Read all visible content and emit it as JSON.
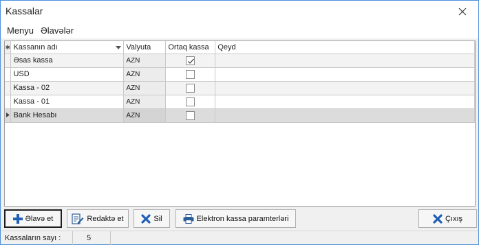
{
  "window": {
    "title": "Kassalar"
  },
  "menu": {
    "items": [
      "Menyu",
      "Əlavələr"
    ]
  },
  "grid": {
    "columns": [
      "Kassanın adı",
      "Valyuta",
      "Ortaq kassa",
      "Qeyd"
    ],
    "rows": [
      {
        "name": "Əsas kassa",
        "currency": "AZN",
        "shared": true,
        "note": ""
      },
      {
        "name": "USD",
        "currency": "AZN",
        "shared": false,
        "note": ""
      },
      {
        "name": "Kassa - 02",
        "currency": "AZN",
        "shared": false,
        "note": ""
      },
      {
        "name": "Kassa - 01",
        "currency": "AZN",
        "shared": false,
        "note": ""
      },
      {
        "name": "Bank Hesabı",
        "currency": "AZN",
        "shared": false,
        "note": ""
      }
    ],
    "selected_row": 4
  },
  "toolbar": {
    "add_label": "Əlavə et",
    "edit_label": "Redaktə et",
    "delete_label": "Sil",
    "ekassa_label": "Elektron kassa paramterləri",
    "exit_label": "Çıxış"
  },
  "status": {
    "count_label": "Kassaların sayı :",
    "count_value": "5"
  },
  "colors": {
    "add_icon": "#1f5fb4",
    "delete_icon": "#1f5fb4",
    "accent_border": "#4a90d9"
  },
  "icons": {
    "close": "close-icon",
    "add": "plus-icon",
    "edit": "edit-document-icon",
    "delete": "x-icon",
    "ekassa": "printer-icon",
    "exit": "x-icon"
  }
}
